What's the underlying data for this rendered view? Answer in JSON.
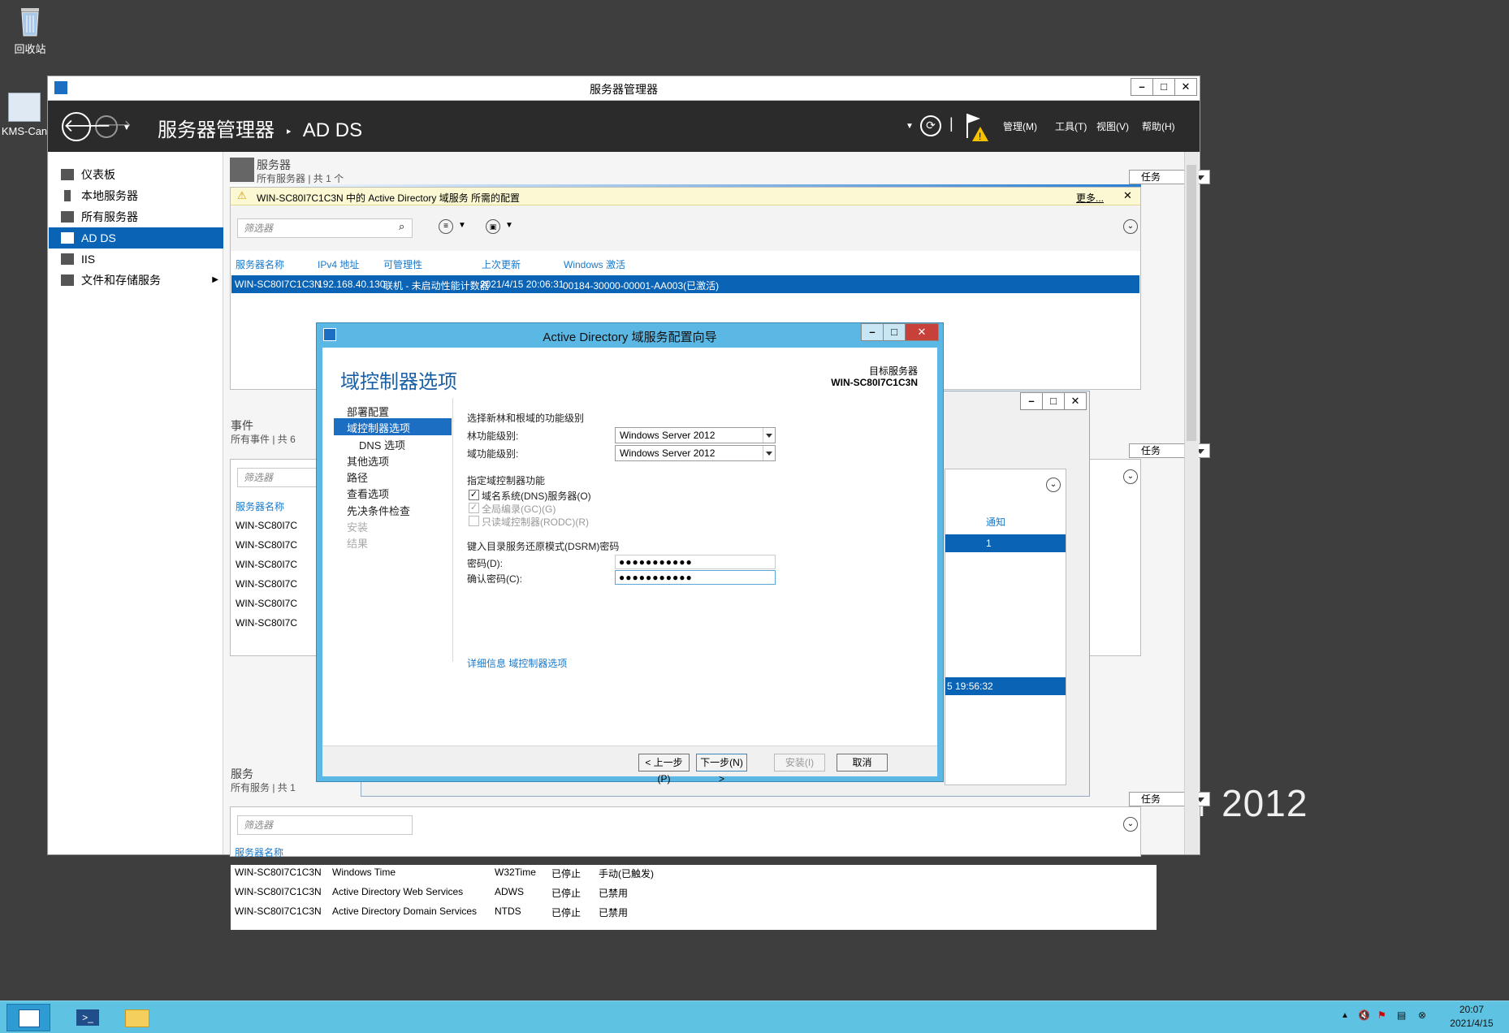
{
  "desktop": {
    "recycle_bin_label": "回收站",
    "kms_label": "KMS-Can",
    "watermark_text": "r 2012"
  },
  "server_manager": {
    "window_title": "服务器管理器",
    "breadcrumb_root": "服务器管理器",
    "breadcrumb_sep": "‣",
    "breadcrumb_current": "AD DS",
    "menu": [
      "管理(M)",
      "工具(T)",
      "视图(V)",
      "帮助(H)"
    ],
    "sidebar": [
      {
        "label": "仪表板",
        "icon": "dashboard-icon"
      },
      {
        "label": "本地服务器",
        "icon": "local-server-icon"
      },
      {
        "label": "所有服务器",
        "icon": "all-servers-icon"
      },
      {
        "label": "AD DS",
        "icon": "ad-ds-icon",
        "selected": true
      },
      {
        "label": "IIS",
        "icon": "iis-icon"
      },
      {
        "label": "文件和存储服务",
        "icon": "file-storage-icon",
        "has_submenu": true
      }
    ],
    "servers_section": {
      "title": "服务器",
      "subtitle": "所有服务器 | 共 1 个",
      "tasks_label": "任务",
      "warning_text": "WIN-SC80I7C1C3N 中的 Active Directory 域服务 所需的配置",
      "warning_more": "更多...",
      "filter_placeholder": "筛选器",
      "columns": [
        "服务器名称",
        "IPv4 地址",
        "可管理性",
        "上次更新",
        "Windows 激活"
      ],
      "rows": [
        [
          "WIN-SC80I7C1C3N",
          "192.168.40.130",
          "联机 - 未启动性能计数器",
          "2021/4/15 20:06:31",
          "00184-30000-00001-AA003(已激活)"
        ]
      ]
    },
    "events_section": {
      "title": "事件",
      "subtitle": "所有事件 | 共 6",
      "tasks_label": "任务",
      "filter_placeholder": "筛选器",
      "column_server": "服务器名称",
      "rows": [
        "WIN-SC80I7C",
        "WIN-SC80I7C",
        "WIN-SC80I7C",
        "WIN-SC80I7C",
        "WIN-SC80I7C",
        "WIN-SC80I7C"
      ]
    },
    "services_section": {
      "title": "服务",
      "subtitle": "所有服务 | 共 1",
      "tasks_label": "任务",
      "filter_placeholder": "筛选器",
      "column_server": "服务器名称",
      "rows": [
        [
          "WIN-SC80I7C1C3N",
          "Windows Time",
          "W32Time",
          "已停止",
          "手动(已触发)"
        ],
        [
          "WIN-SC80I7C1C3N",
          "Active Directory Web Services",
          "ADWS",
          "已停止",
          "已禁用"
        ],
        [
          "WIN-SC80I7C1C3N",
          "Active Directory Domain Services",
          "NTDS",
          "已停止",
          "已禁用"
        ]
      ]
    }
  },
  "background_dialog": {
    "col_notify": "通知",
    "row_value": "1",
    "timestamp": "5 19:56:32"
  },
  "wizard": {
    "title": "Active Directory 域服务配置向导",
    "heading": "域控制器选项",
    "target_label": "目标服务器",
    "target_server": "WIN-SC80I7C1C3N",
    "nav": [
      {
        "label": "部署配置",
        "state": "normal"
      },
      {
        "label": "域控制器选项",
        "state": "selected"
      },
      {
        "label": "DNS 选项",
        "state": "sub"
      },
      {
        "label": "其他选项",
        "state": "normal"
      },
      {
        "label": "路径",
        "state": "normal"
      },
      {
        "label": "查看选项",
        "state": "normal"
      },
      {
        "label": "先决条件检查",
        "state": "normal"
      },
      {
        "label": "安装",
        "state": "disabled"
      },
      {
        "label": "结果",
        "state": "disabled"
      }
    ],
    "func_level_heading": "选择新林和根域的功能级别",
    "forest_level_label": "林功能级别:",
    "forest_level_value": "Windows Server 2012",
    "domain_level_label": "域功能级别:",
    "domain_level_value": "Windows Server 2012",
    "dc_caps_heading": "指定域控制器功能",
    "dns_checkbox": {
      "label": "域名系统(DNS)服务器(O)",
      "checked": true,
      "enabled": true
    },
    "gc_checkbox": {
      "label": "全局编录(GC)(G)",
      "checked": true,
      "enabled": false
    },
    "rodc_checkbox": {
      "label": "只读域控制器(RODC)(R)",
      "checked": false,
      "enabled": false
    },
    "dsrm_heading": "键入目录服务还原模式(DSRM)密码",
    "password_label": "密码(D):",
    "password_value": "●●●●●●●●●●●",
    "confirm_label": "确认密码(C):",
    "confirm_value": "●●●●●●●●●●●",
    "more_info_link": "详细信息 域控制器选项",
    "buttons": {
      "prev": "< 上一步(P)",
      "next": "下一步(N) >",
      "install": "安装(I)",
      "cancel": "取消"
    }
  },
  "taskbar": {
    "clock_time": "20:07",
    "clock_date": "2021/4/15"
  },
  "colors": {
    "accent": "#0a63b5",
    "header_bg": "#2b2b2b",
    "wizard_frame": "#5bb7e4",
    "taskbar": "#5ec3e3",
    "desktop": "#3e3e3e"
  }
}
